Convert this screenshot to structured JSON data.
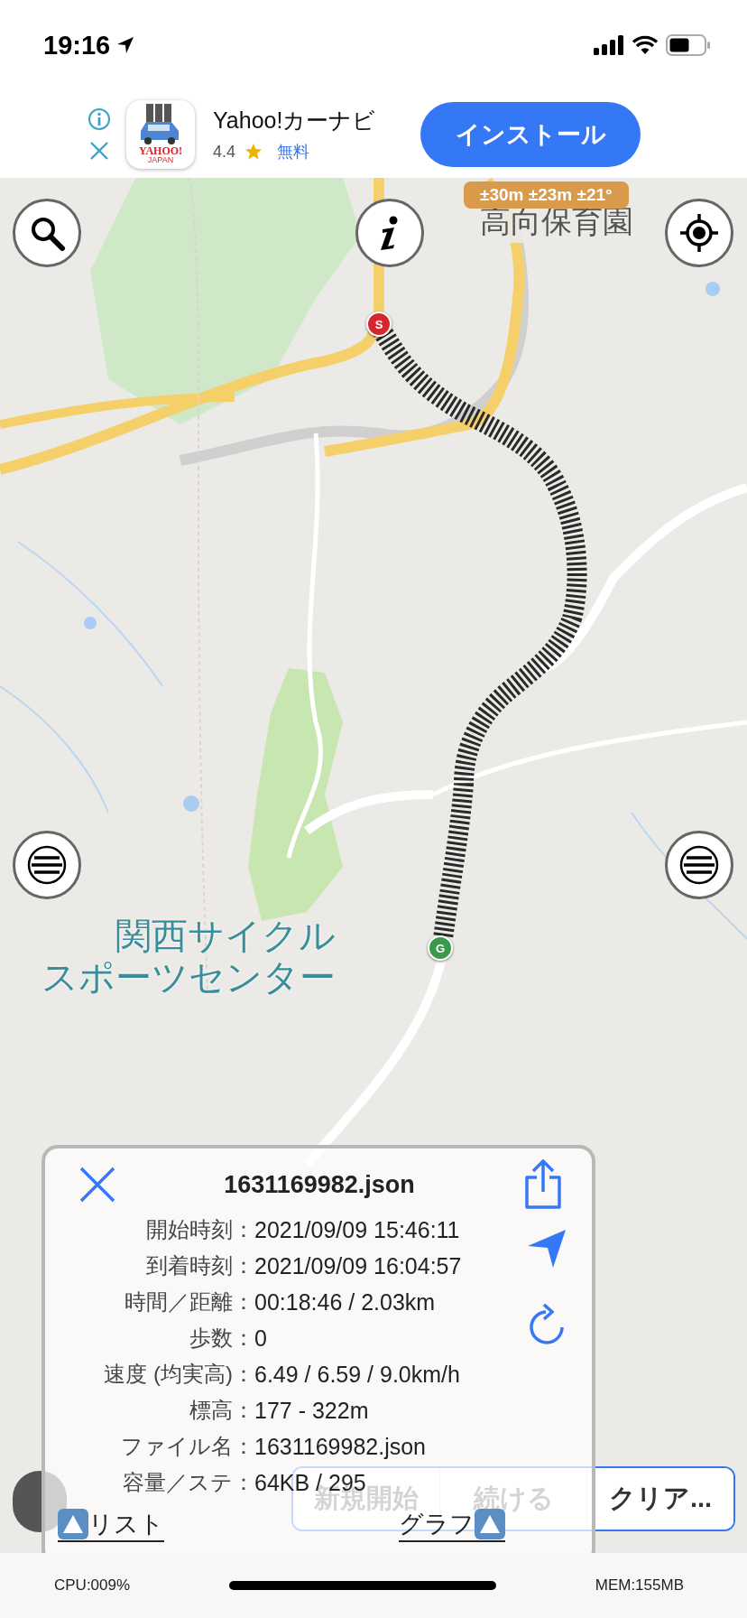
{
  "status_bar": {
    "time": "19:16"
  },
  "ad": {
    "logo_text": [
      "YAHOO!",
      "JAPAN"
    ],
    "app_name": "Yahoo!カーナビ",
    "rating": "4.4",
    "price": "無料",
    "install_button": "インストール"
  },
  "map": {
    "accuracy": "±30m ±23m ±21°",
    "labels": [
      {
        "kind": "poi",
        "text": "高向保育園"
      },
      {
        "kind": "area",
        "text": "関西サイクル"
      },
      {
        "kind": "area",
        "text": "スポーツセンター"
      }
    ],
    "markers": [
      {
        "kind": "start",
        "label": "S"
      },
      {
        "kind": "goal",
        "label": "G"
      }
    ]
  },
  "control_bar": {
    "segments": [
      {
        "label": "新規開始",
        "disabled": true
      },
      {
        "label": "続ける",
        "disabled": true
      },
      {
        "label": "クリア...",
        "disabled": false
      }
    ]
  },
  "track_panel": {
    "title": "1631169982.json",
    "rows": [
      {
        "label": "開始時刻",
        "value": "2021/09/09 15:46:11"
      },
      {
        "label": "到着時刻",
        "value": "2021/09/09 16:04:57"
      },
      {
        "label": "時間／距離",
        "value": "00:18:46 / 2.03km"
      },
      {
        "label": "歩数",
        "value": "0"
      },
      {
        "label": "速度 (均実高)",
        "value": "6.49 / 6.59 / 9.0km/h"
      },
      {
        "label": "標高",
        "value": "177 - 322m"
      },
      {
        "label": "ファイル名",
        "value": "1631169982.json"
      },
      {
        "label": "容量／ステ",
        "value": "64KB / 295"
      }
    ],
    "separator": "：",
    "list_link": "リスト",
    "graph_link": "グラフ"
  },
  "footer": {
    "cpu": "CPU:009%",
    "mem": "MEM:155MB"
  }
}
